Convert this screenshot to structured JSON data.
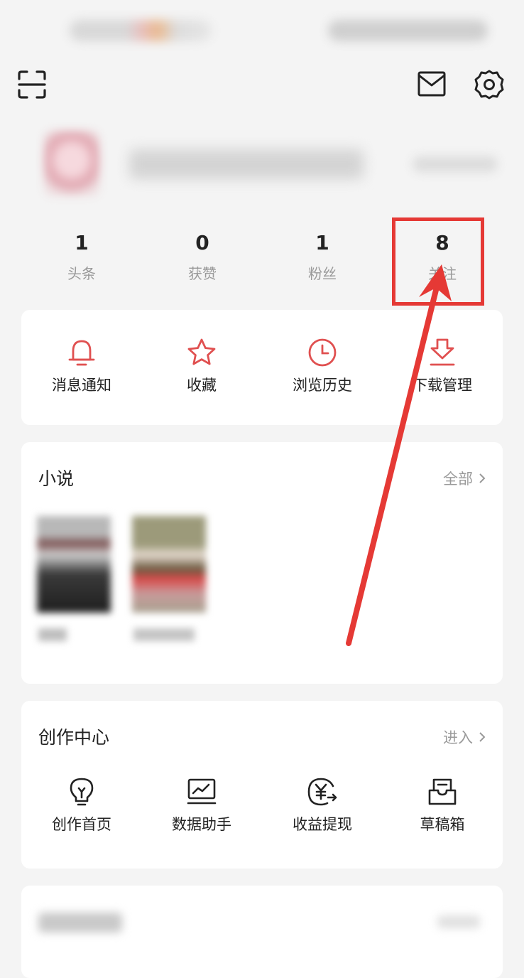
{
  "stats": [
    {
      "value": "1",
      "label": "头条"
    },
    {
      "value": "0",
      "label": "获赞"
    },
    {
      "value": "1",
      "label": "粉丝"
    },
    {
      "value": "8",
      "label": "关注"
    }
  ],
  "quick_actions": [
    {
      "label": "消息通知",
      "icon": "bell-icon"
    },
    {
      "label": "收藏",
      "icon": "star-icon"
    },
    {
      "label": "浏览历史",
      "icon": "clock-icon"
    },
    {
      "label": "下载管理",
      "icon": "download-icon"
    }
  ],
  "novels": {
    "title": "小说",
    "link": "全部"
  },
  "creator": {
    "title": "创作中心",
    "link": "进入",
    "items": [
      {
        "label": "创作首页",
        "icon": "lightbulb-icon"
      },
      {
        "label": "数据助手",
        "icon": "chart-icon"
      },
      {
        "label": "收益提现",
        "icon": "yen-icon"
      },
      {
        "label": "草稿箱",
        "icon": "drafts-icon"
      }
    ]
  },
  "colors": {
    "accent": "#e05050",
    "annotation": "#e53935",
    "background": "#f4f4f4"
  }
}
